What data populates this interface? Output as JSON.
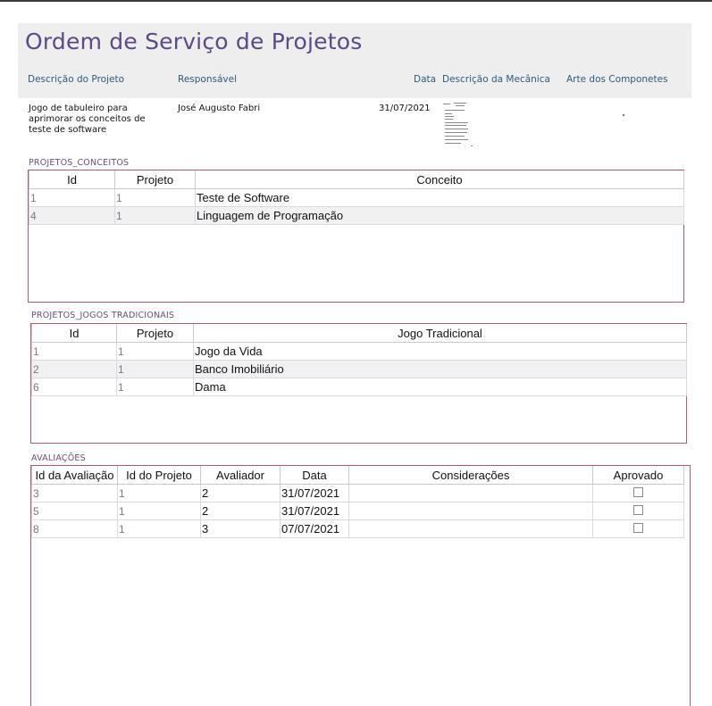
{
  "header": {
    "title": "Ordem de Serviço de Projetos",
    "labels": {
      "descricao": "Descrição do Projeto",
      "responsavel": "Responsável",
      "data": "Data",
      "mecanica": "Descrição da Mecânica",
      "arte": "Arte dos Componetes"
    }
  },
  "record": {
    "descricao_line1": "Jogo de tabuleiro para",
    "descricao_line2": "aprimorar os conceitos de",
    "descricao_line3": "teste de software",
    "responsavel": "José Augusto Fabri",
    "data": "31/07/2021"
  },
  "conceitos": {
    "label": "PROJETOS_CONCEITOS",
    "columns": [
      "Id",
      "Projeto",
      "Conceito"
    ],
    "rows": [
      {
        "id": "1",
        "projeto": "1",
        "conceito": "Teste de Software"
      },
      {
        "id": "4",
        "projeto": "1",
        "conceito": "Linguagem de Programação"
      }
    ]
  },
  "jogos": {
    "label": "PROJETOS_JOGOS TRADICIONAIS",
    "columns": [
      "Id",
      "Projeto",
      "Jogo Tradicional"
    ],
    "rows": [
      {
        "id": "1",
        "projeto": "1",
        "jogo": "Jogo da Vida"
      },
      {
        "id": "2",
        "projeto": "1",
        "jogo": "Banco Imobiliário"
      },
      {
        "id": "6",
        "projeto": "1",
        "jogo": "Dama"
      }
    ]
  },
  "avaliacoes": {
    "label": "AVALIAÇÕES",
    "columns": [
      "Id da Avaliação",
      "Id do Projeto",
      "Avaliador",
      "Data",
      "Considerações",
      "Aprovado"
    ],
    "rows": [
      {
        "id": "3",
        "projeto": "1",
        "avaliador": "2",
        "data": "31/07/2021",
        "consideracoes": "",
        "aprovado": false
      },
      {
        "id": "5",
        "projeto": "1",
        "avaliador": "2",
        "data": "31/07/2021",
        "consideracoes": "",
        "aprovado": false
      },
      {
        "id": "8",
        "projeto": "1",
        "avaliador": "3",
        "data": "07/07/2021",
        "consideracoes": "",
        "aprovado": false
      }
    ]
  }
}
